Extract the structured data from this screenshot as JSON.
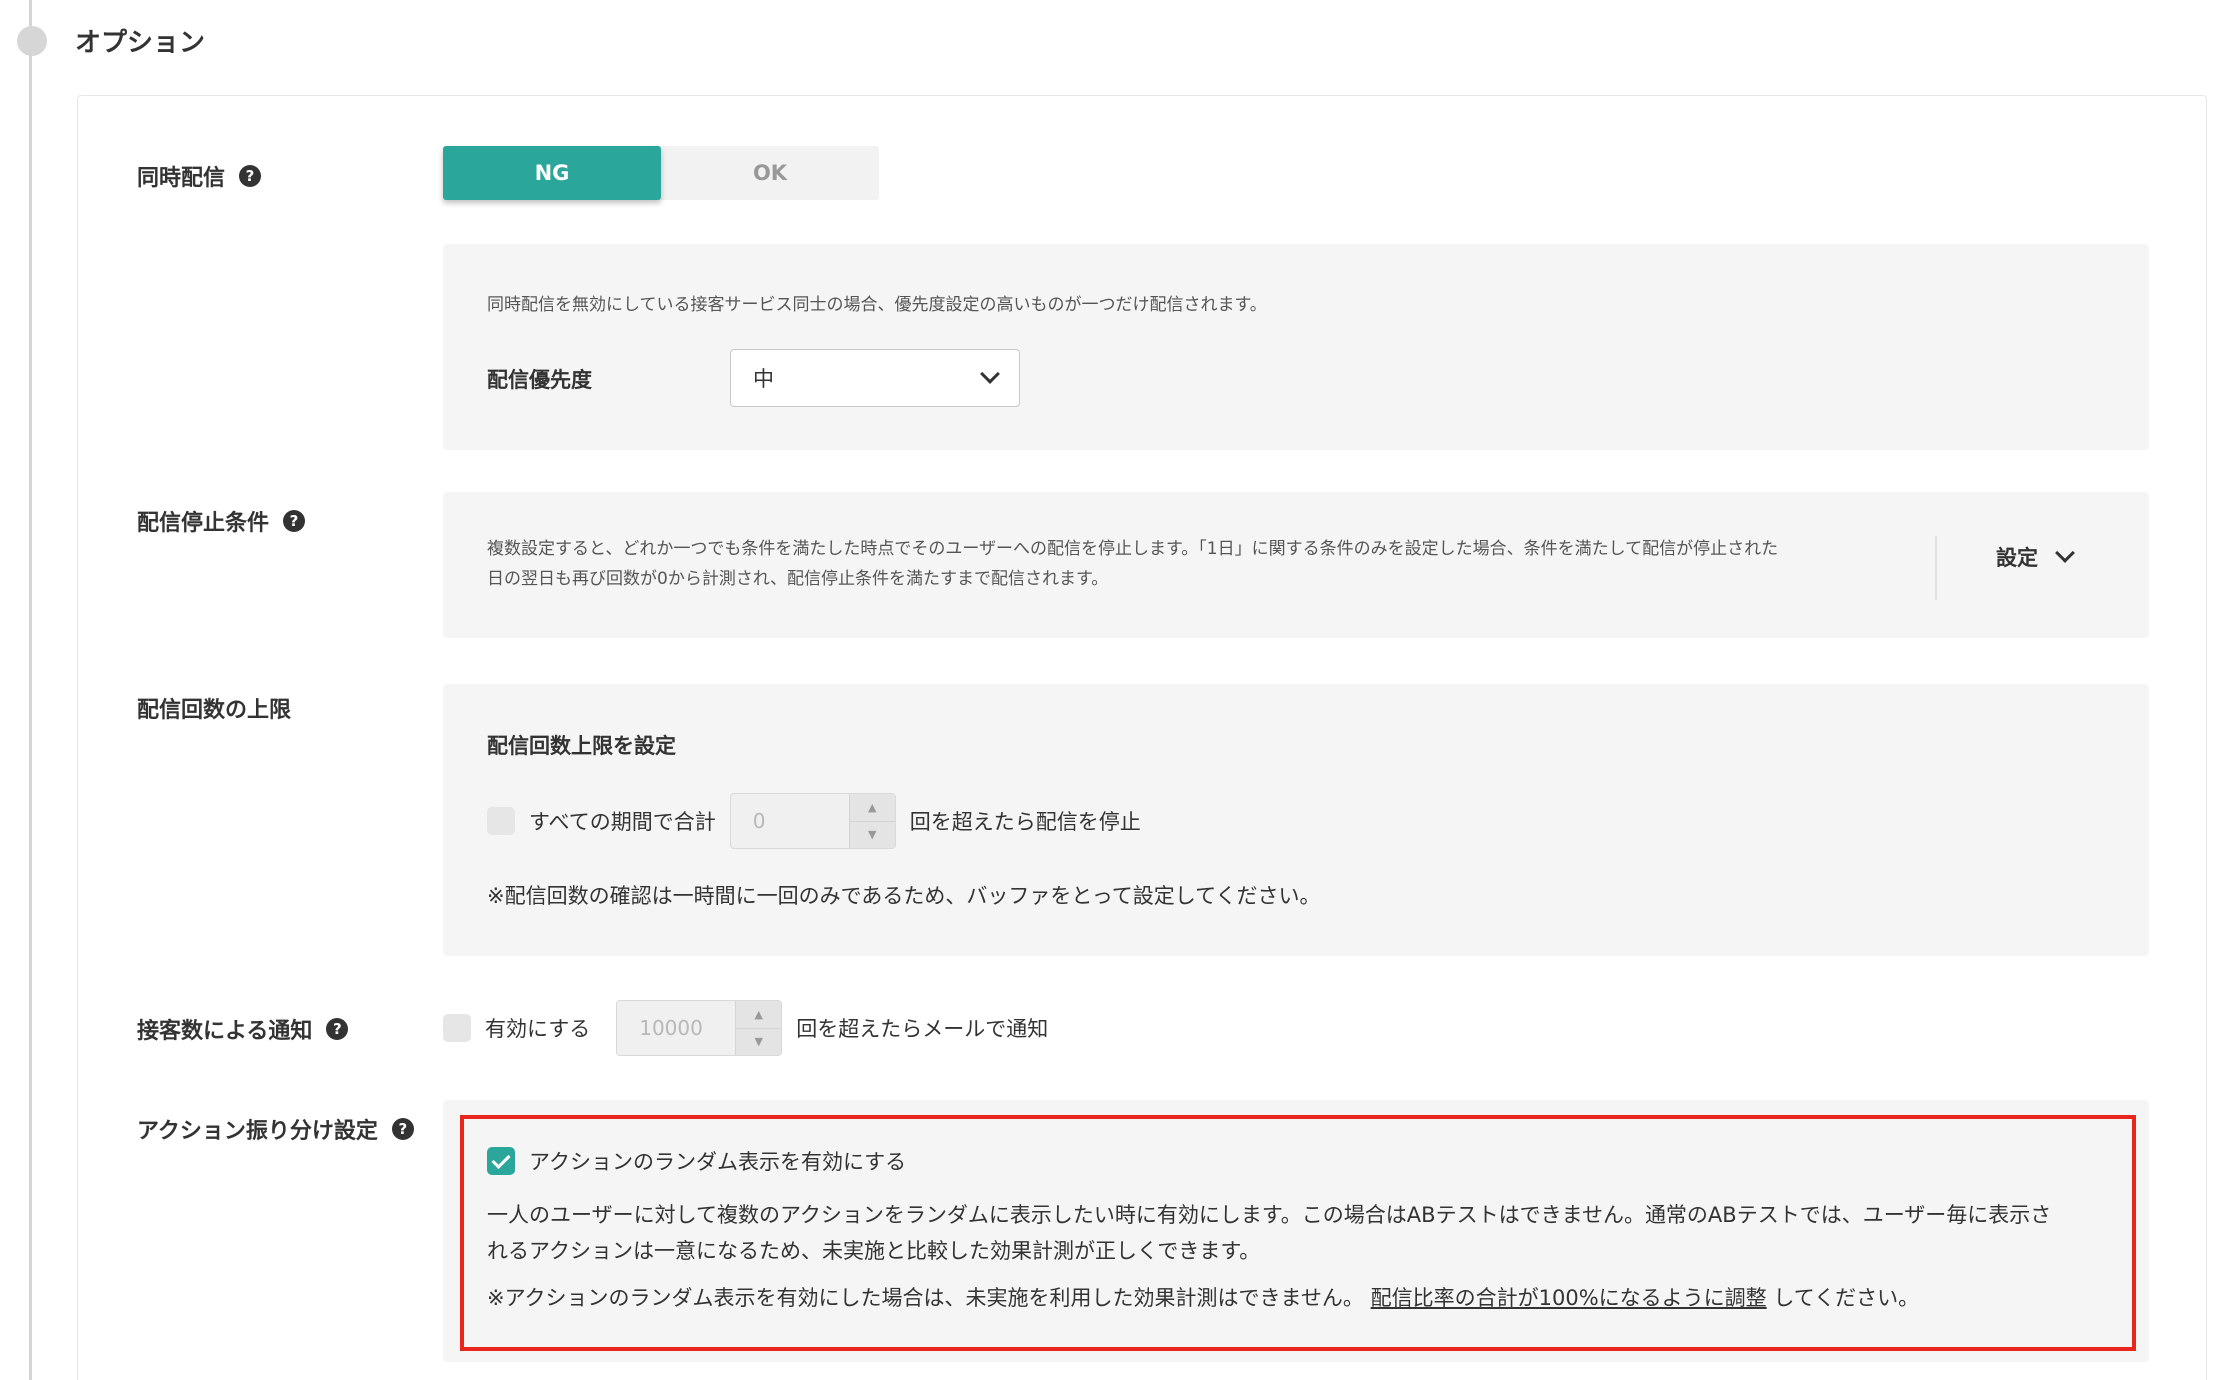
{
  "section_title": "オプション",
  "simultaneous": {
    "label": "同時配信",
    "help": "?",
    "toggle": {
      "ng": "NG",
      "ok": "OK",
      "selected": "NG"
    },
    "description": "同時配信を無効にしている接客サービス同士の場合、優先度設定の高いものが一つだけ配信されます。",
    "priority_label": "配信優先度",
    "priority_value": "中"
  },
  "stop_condition": {
    "label": "配信停止条件",
    "help": "?",
    "description_line1": "複数設定すると、どれか一つでも条件を満たした時点でそのユーザーへの配信を停止します。「1日」に関する条件のみを設定した場合、条件を満たして配信が停止された",
    "description_line2": "日の翌日も再び回数が0から計測され、配信停止条件を満たすまで配信されます。",
    "setting_label": "設定"
  },
  "limit": {
    "label": "配信回数の上限",
    "box_title": "配信回数上限を設定",
    "checkbox_label": "すべての期間で合計",
    "value": "0",
    "suffix": "回を超えたら配信を停止",
    "note": "※配信回数の確認は一時間に一回のみであるため、バッファをとって設定してください。"
  },
  "notify": {
    "label": "接客数による通知",
    "help": "?",
    "checkbox_label": "有効にする",
    "value": "10000",
    "suffix": "回を超えたらメールで通知"
  },
  "action_split": {
    "label": "アクション振り分け設定",
    "help": "?",
    "checkbox_label": "アクションのランダム表示を有効にする",
    "checked": true,
    "description_line1": "一人のユーザーに対して複数のアクションをランダムに表示したい時に有効にします。この場合はABテストはできません。通常のABテストでは、ユーザー毎に表示さ",
    "description_line2": "れるアクションは一意になるため、未実施と比較した効果計測が正しくできます。",
    "note_prefix": "※アクションのランダム表示を有効にした場合は、未実施を利用した効果計測はできません。",
    "note_link": "配信比率の合計が100%になるように調整",
    "note_suffix": "してください。"
  },
  "colors": {
    "accent": "#2aa69a",
    "highlight_frame": "#e8261b"
  }
}
